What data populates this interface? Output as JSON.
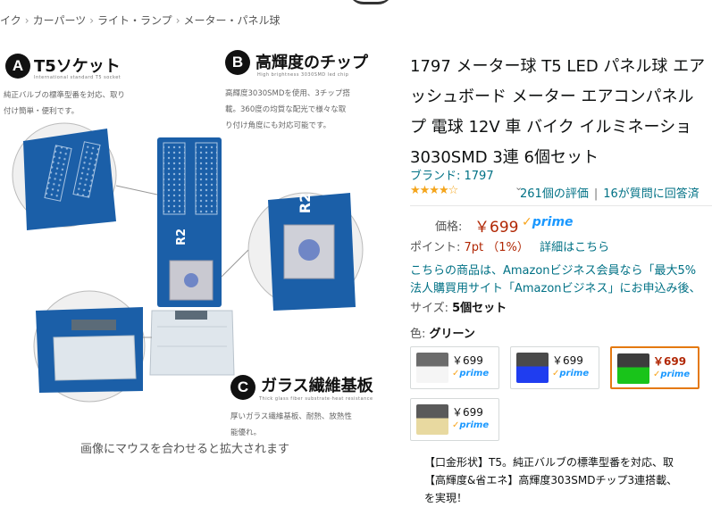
{
  "breadcrumb": {
    "items": [
      "イク",
      "カーパーツ",
      "ライト・ランプ",
      "メーター・パネル球"
    ],
    "separator": "›"
  },
  "image": {
    "feature_a": {
      "letter": "A",
      "title": "T5ソケット",
      "subtitle": "International standard T5 socket",
      "desc_lines": [
        "純正バルブの標準型番を対応、取り",
        "付け簡単・便利です。"
      ]
    },
    "feature_b": {
      "letter": "B",
      "title": "高輝度のチップ",
      "subtitle": "High brightness 3030SMD led chip",
      "desc_lines": [
        "高輝度3030SMDを使用、3チップ搭",
        "載。360度の均質な配光で様々な取",
        "り付け角度にも対応可能です。"
      ]
    },
    "feature_c": {
      "letter": "C",
      "title": "ガラス繊維基板",
      "subtitle": "Thick glass fiber substrate·heat resistance",
      "desc_lines": [
        "厚いガラス繊維基板、耐熱、放熱性",
        "能優れ。"
      ]
    },
    "pcb_marking": "R2",
    "zoom_hint": "画像にマウスを合わせると拡大されます"
  },
  "product": {
    "title_lines": [
      "1797 メーター球 T5 LED パネル球 エア",
      "ッシュボード メーター エアコンパネル",
      "プ 電球 12V 車 バイク イルミネーショ",
      "3030SMD 3連 6個セット"
    ],
    "brand": "ブランド: 1797",
    "stars_filled": "★★★★",
    "stars_empty": "☆",
    "rating_value": 4,
    "chevron": "⌄",
    "ratings": "261個の評価",
    "questions": "16が質問に回答済",
    "price_label": "価格:",
    "price": "￥699",
    "prime_check": "✓",
    "prime": "prime",
    "points_label": "ポイント:",
    "points_value": "7pt （1%）",
    "points_link": "詳細はこちら",
    "biz_lines": [
      "こちらの商品は、Amazonビジネス会員なら「最大5%",
      "法人購買用サイト「Amazonビジネス」にお申込み後、"
    ],
    "size_label": "サイズ:",
    "size_value": "5個セット",
    "color_label": "色:",
    "color_value": "グリーン",
    "swatches": [
      {
        "price": "￥699",
        "prime": "prime",
        "color": "white",
        "selected": false
      },
      {
        "price": "￥699",
        "prime": "prime",
        "color": "blue",
        "selected": false
      },
      {
        "price": "￥699",
        "prime": "prime",
        "color": "green",
        "selected": true
      },
      {
        "price": "￥699",
        "prime": "prime",
        "color": "warm-white",
        "selected": false
      }
    ],
    "bullets": [
      "【口金形状】T5。純正バルブの標準型番を対応、取",
      "【高輝度&省エネ】高輝度303SMDチップ3連搭載、",
      "を実現！"
    ]
  },
  "colors": {
    "link": "#007185",
    "price": "#b12704",
    "prime": "#1a98ff",
    "star": "#f4a51c",
    "selected_border": "#e47911",
    "pcb": "#1b5fa8"
  }
}
